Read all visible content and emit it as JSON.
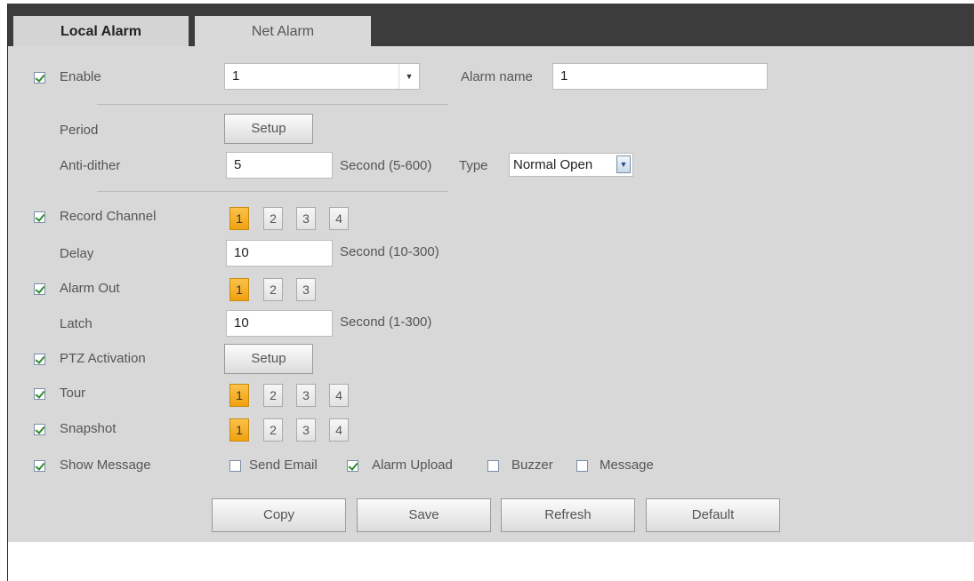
{
  "tabs": {
    "local": "Local Alarm",
    "net": "Net Alarm"
  },
  "enable": {
    "label": "Enable",
    "checked": true,
    "value": "1"
  },
  "alarm_name": {
    "label": "Alarm name",
    "value": "1"
  },
  "period": {
    "label": "Period",
    "button": "Setup"
  },
  "anti_dither": {
    "label": "Anti-dither",
    "value": "5",
    "unit": "Second (5-600)",
    "type_label": "Type",
    "type_value": "Normal Open"
  },
  "record_channel": {
    "label": "Record Channel",
    "checked": true,
    "channels": [
      "1",
      "2",
      "3",
      "4"
    ],
    "selected": "1"
  },
  "delay": {
    "label": "Delay",
    "value": "10",
    "unit": "Second (10-300)"
  },
  "alarm_out": {
    "label": "Alarm Out",
    "checked": true,
    "channels": [
      "1",
      "2",
      "3"
    ],
    "selected": "1"
  },
  "latch": {
    "label": "Latch",
    "value": "10",
    "unit": "Second (1-300)"
  },
  "ptz": {
    "label": "PTZ Activation",
    "checked": true,
    "button": "Setup"
  },
  "tour": {
    "label": "Tour",
    "checked": true,
    "channels": [
      "1",
      "2",
      "3",
      "4"
    ],
    "selected": "1"
  },
  "snapshot": {
    "label": "Snapshot",
    "checked": true,
    "channels": [
      "1",
      "2",
      "3",
      "4"
    ],
    "selected": "1"
  },
  "show_message": {
    "label": "Show Message",
    "checked": true
  },
  "options": {
    "send_email": {
      "label": "Send Email",
      "checked": false
    },
    "alarm_upload": {
      "label": "Alarm Upload",
      "checked": true
    },
    "buzzer": {
      "label": "Buzzer",
      "checked": false
    },
    "message": {
      "label": "Message",
      "checked": false
    }
  },
  "buttons": {
    "copy": "Copy",
    "save": "Save",
    "refresh": "Refresh",
    "default": "Default"
  },
  "colors": {
    "selected_channel": "#f0a20e",
    "panel": "#d8d8d8",
    "header": "#3c3c3c"
  }
}
